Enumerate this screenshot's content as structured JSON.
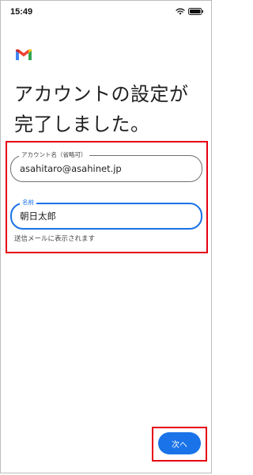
{
  "status_bar": {
    "time": "15:49",
    "wifi_icon": "wifi-icon",
    "battery_icon": "battery-icon"
  },
  "app": {
    "logo_icon": "gmail-logo-icon",
    "brand_colors": {
      "blue": "#4285F4",
      "red": "#EA4335",
      "yellow": "#FBBC04",
      "green": "#34A853"
    }
  },
  "page": {
    "title": "アカウントの設定が完了しました。"
  },
  "form": {
    "account_name": {
      "label": "アカウント名（省略可）",
      "value": "asahitaro@asahinet.jp"
    },
    "name": {
      "label": "名前",
      "value": "朝日太郎"
    },
    "helper": "送信メールに表示されます"
  },
  "actions": {
    "next_label": "次へ"
  },
  "colors": {
    "accent": "#1a73e8",
    "highlight": "#e60012"
  }
}
